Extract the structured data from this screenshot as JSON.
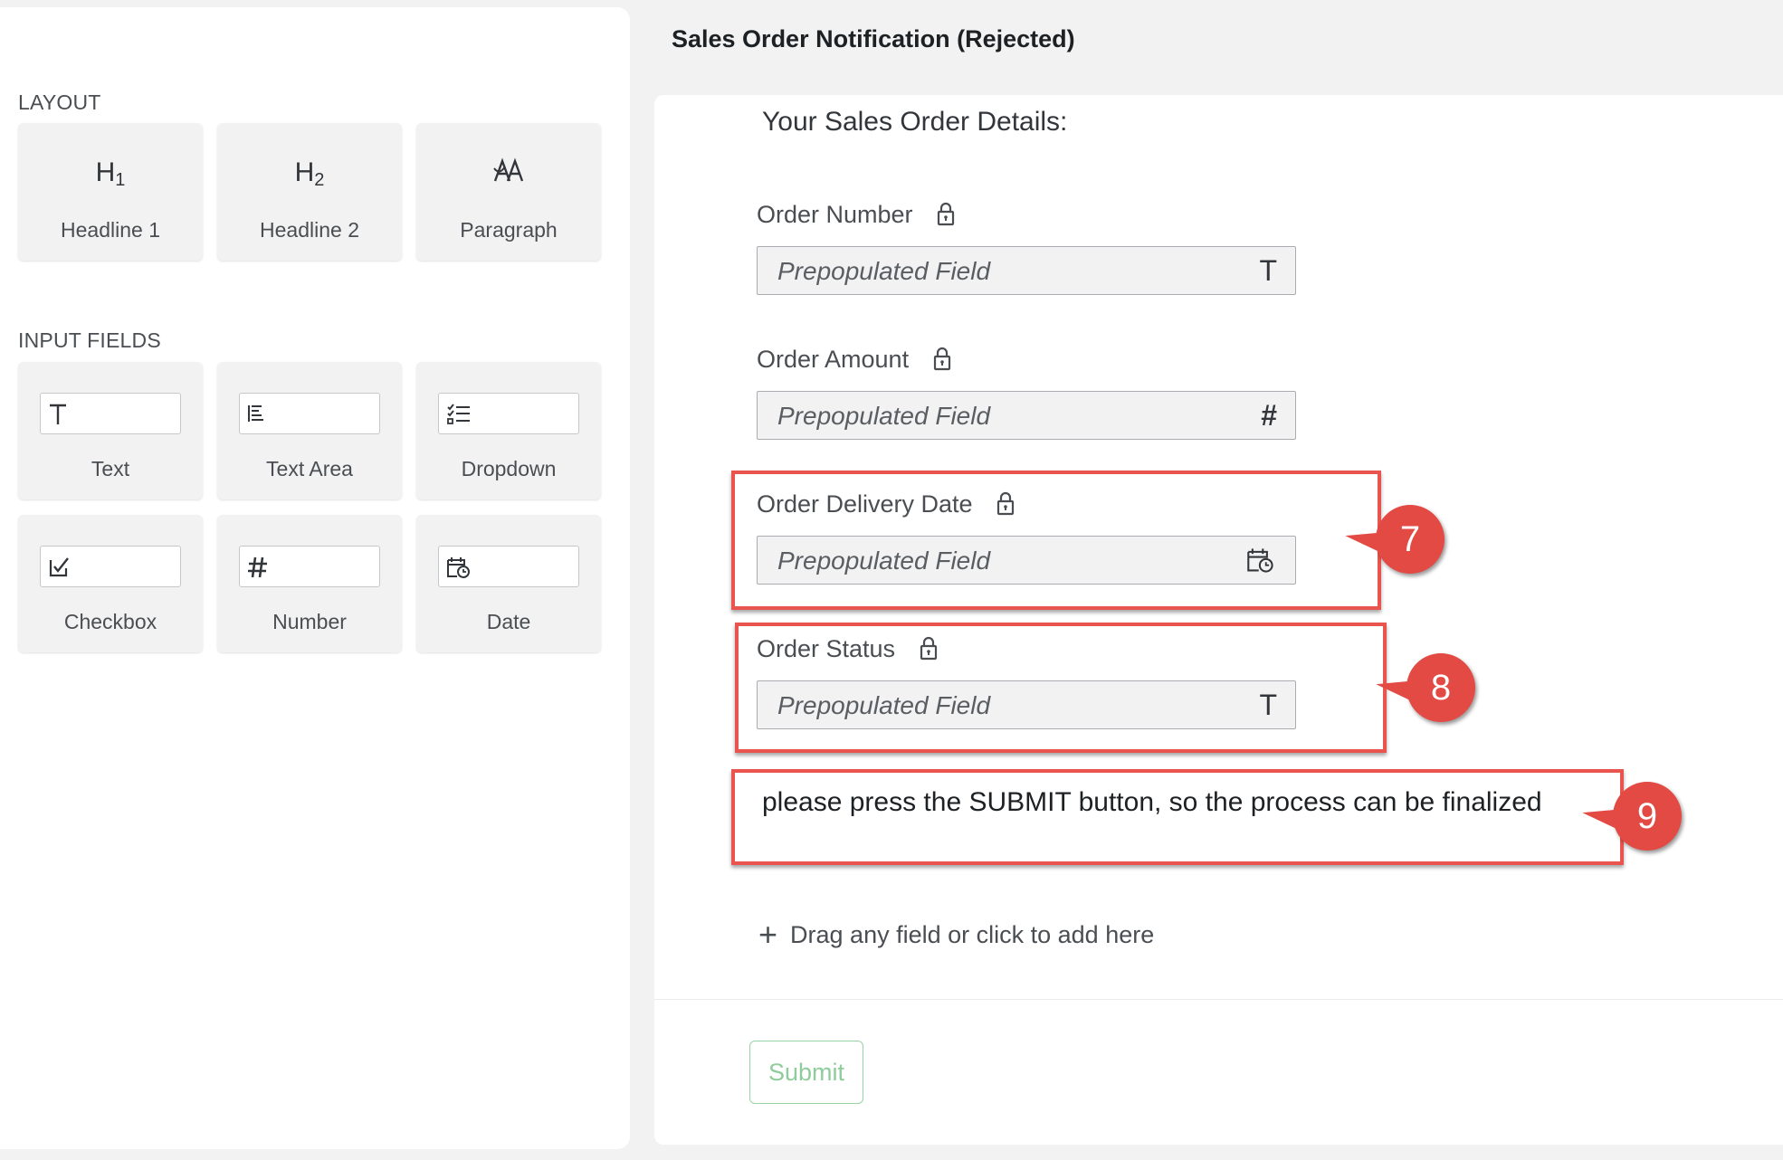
{
  "palette": {
    "layout_title": "LAYOUT",
    "layout_items": [
      {
        "glyph": "H",
        "sub": "1",
        "label": "Headline 1",
        "icon": "headline-1-icon"
      },
      {
        "glyph": "H",
        "sub": "2",
        "label": "Headline 2",
        "icon": "headline-2-icon"
      },
      {
        "label": "Paragraph",
        "icon": "paragraph-icon"
      }
    ],
    "input_title": "INPUT FIELDS",
    "input_items": [
      {
        "label": "Text",
        "icon": "text-icon"
      },
      {
        "label": "Text Area",
        "icon": "text-area-icon"
      },
      {
        "label": "Dropdown",
        "icon": "dropdown-icon"
      },
      {
        "label": "Checkbox",
        "icon": "checkbox-icon"
      },
      {
        "label": "Number",
        "icon": "number-icon"
      },
      {
        "label": "Date",
        "icon": "date-icon"
      }
    ]
  },
  "form": {
    "title": "Sales Order Notification (Rejected)",
    "heading": "Your Sales Order Details:",
    "fields": [
      {
        "label": "Order Number",
        "placeholder": "Prepopulated Field",
        "type_icon": "text-icon",
        "glyph": "T"
      },
      {
        "label": "Order Amount",
        "placeholder": "Prepopulated Field",
        "type_icon": "number-icon",
        "glyph": "#"
      },
      {
        "label": "Order Delivery Date",
        "placeholder": "Prepopulated Field",
        "type_icon": "date-icon"
      },
      {
        "label": "Order Status",
        "placeholder": "Prepopulated Field",
        "type_icon": "text-icon",
        "glyph": "T"
      }
    ],
    "paragraph": "please press the SUBMIT button, so the process can be finalized",
    "add_hint": "Drag any field or click to add here",
    "submit_label": "Submit"
  },
  "callouts": [
    "7",
    "8",
    "9"
  ],
  "colors": {
    "highlight": "#e9554e",
    "callout": "#e34a43",
    "submit_border": "#9ad3a5"
  }
}
